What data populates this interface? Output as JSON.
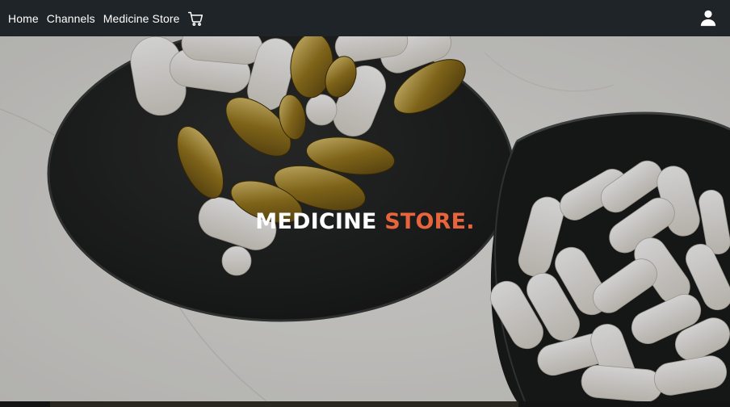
{
  "nav": {
    "home": "Home",
    "channels": "Channels",
    "medicine_store": "Medicine Store",
    "cart_icon": "shopping-cart-icon",
    "user_icon": "user-icon"
  },
  "hero": {
    "title_main": "MEDICINE",
    "title_accent": "STORE.",
    "accent_color": "#e8643c"
  }
}
